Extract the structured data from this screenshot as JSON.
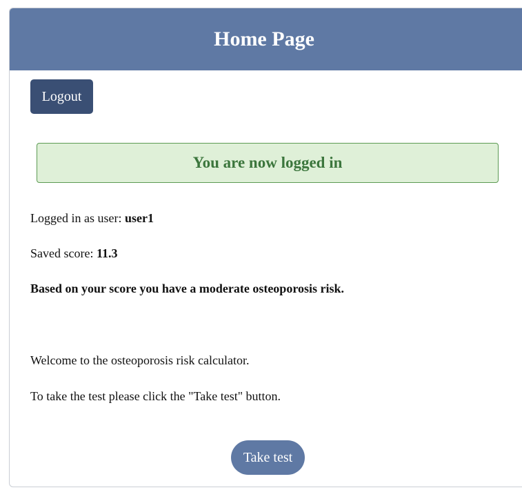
{
  "header": {
    "title": "Home Page"
  },
  "toolbar": {
    "logout_label": "Logout"
  },
  "alert": {
    "message": "You are now logged in"
  },
  "user_info": {
    "logged_in_prefix": "Logged in as user: ",
    "username": "user1",
    "score_prefix": "Saved score: ",
    "score": "11.3",
    "risk_message": "Based on your score you have a moderate osteoporosis risk."
  },
  "intro": {
    "welcome": "Welcome to the osteoporosis risk calculator.",
    "instruction": "To take the test please click the \"Take test\" button."
  },
  "actions": {
    "take_test_label": "Take test"
  },
  "colors": {
    "header_bg": "#5f79a4",
    "logout_bg": "#3a4f74",
    "alert_bg": "#dff0d8",
    "alert_border": "#5b9a52",
    "alert_text": "#3c763d",
    "take_test_bg": "#5f79a4"
  }
}
